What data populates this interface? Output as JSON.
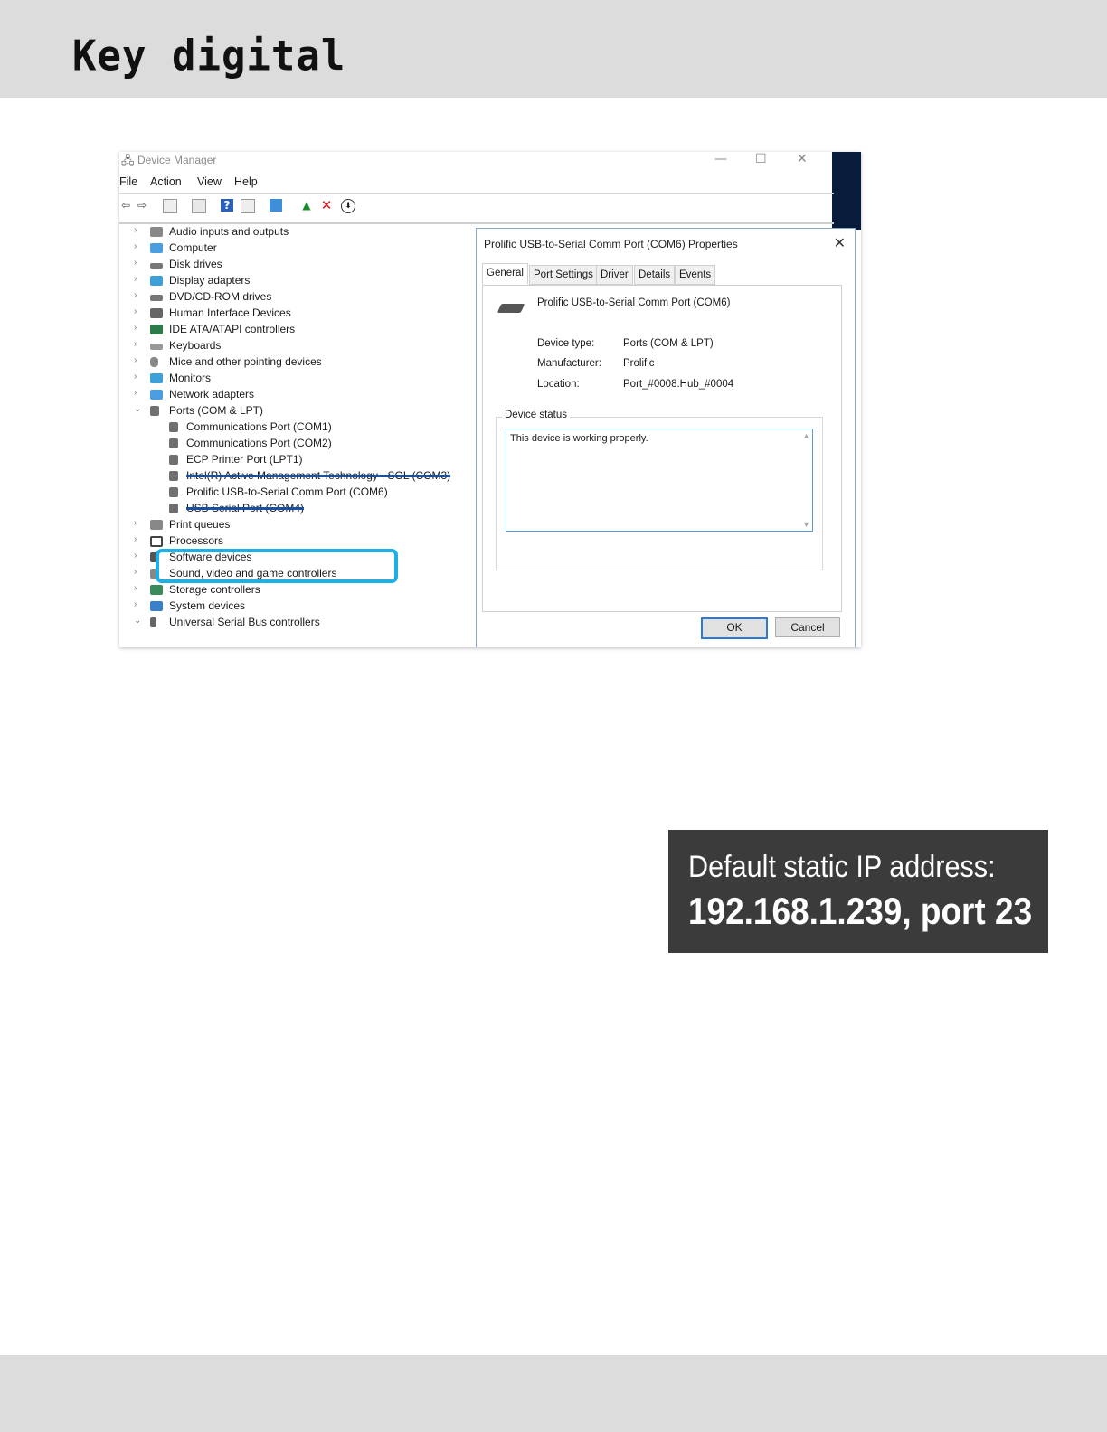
{
  "brand": {
    "logo_text": "Key digital"
  },
  "device_manager": {
    "title": "Device Manager",
    "window_controls": [
      "—",
      "☐",
      "✕"
    ],
    "menu": [
      "File",
      "Action",
      "View",
      "Help"
    ],
    "tree": [
      {
        "label": "Audio inputs and outputs",
        "expanded": false
      },
      {
        "label": "Computer",
        "expanded": false
      },
      {
        "label": "Disk drives",
        "expanded": false
      },
      {
        "label": "Display adapters",
        "expanded": false
      },
      {
        "label": "DVD/CD-ROM drives",
        "expanded": false
      },
      {
        "label": "Human Interface Devices",
        "expanded": false
      },
      {
        "label": "IDE ATA/ATAPI controllers",
        "expanded": false
      },
      {
        "label": "Keyboards",
        "expanded": false
      },
      {
        "label": "Mice and other pointing devices",
        "expanded": false
      },
      {
        "label": "Monitors",
        "expanded": false
      },
      {
        "label": "Network adapters",
        "expanded": false
      },
      {
        "label": "Ports (COM & LPT)",
        "expanded": true
      },
      {
        "label": "Communications Port (COM1)",
        "child": true
      },
      {
        "label": "Communications Port (COM2)",
        "child": true
      },
      {
        "label": "ECP Printer Port (LPT1)",
        "child": true
      },
      {
        "label": "Intel(R) Active Management Technology - SOL (COM3)",
        "child": true
      },
      {
        "label": "Prolific USB-to-Serial Comm Port (COM6)",
        "child": true,
        "highlighted": true
      },
      {
        "label": "USB Serial Port (COM4)",
        "child": true
      },
      {
        "label": "Print queues",
        "expanded": false
      },
      {
        "label": "Processors",
        "expanded": false
      },
      {
        "label": "Software devices",
        "expanded": false
      },
      {
        "label": "Sound, video and game controllers",
        "expanded": false
      },
      {
        "label": "Storage controllers",
        "expanded": false
      },
      {
        "label": "System devices",
        "expanded": false
      },
      {
        "label": "Universal Serial Bus controllers",
        "expanded": true
      }
    ],
    "highlight_color": "#1cb1e6"
  },
  "properties_dialog": {
    "title": "Prolific USB-to-Serial Comm Port (COM6) Properties",
    "tabs": [
      "General",
      "Port Settings",
      "Driver",
      "Details",
      "Events"
    ],
    "active_tab": "General",
    "device_name": "Prolific USB-to-Serial Comm Port (COM6)",
    "device_type_label": "Device type:",
    "device_type": "Ports (COM & LPT)",
    "manufacturer_label": "Manufacturer:",
    "manufacturer": "Prolific",
    "location_label": "Location:",
    "location": "Port_#0008.Hub_#0004",
    "status_legend": "Device status",
    "status_text": "This device is working properly.",
    "ok_label": "OK",
    "cancel_label": "Cancel"
  },
  "ip_callout": {
    "label": "Default static IP address:",
    "value": "192.168.1.239,  port 23",
    "background": "#3b3b3b"
  }
}
